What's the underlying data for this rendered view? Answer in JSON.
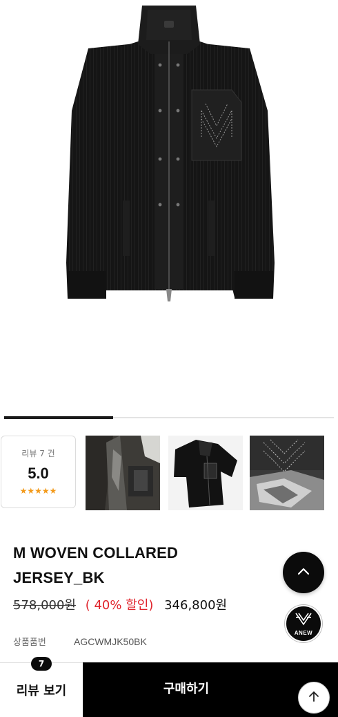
{
  "product": {
    "title_line1": "M WOVEN COLLARED",
    "title_line2": "JERSEY_BK",
    "original_price": "578,000원",
    "discount": "( 40% 할인)",
    "final_price": "346,800원",
    "code_label": "상품품번",
    "code_value": "AGCWMJK50BK",
    "garment_embroidery": "ANEW"
  },
  "gallery": {
    "progress_fraction": 0.33
  },
  "review_summary": {
    "count_label": "리뷰 7 건",
    "score": "5.0",
    "stars": "★★★★★",
    "star_color": "#f39a1a"
  },
  "thumbnails": [
    {
      "name": "thumb-detail-front"
    },
    {
      "name": "thumb-flatlay-back"
    },
    {
      "name": "thumb-pocket-closeup"
    }
  ],
  "fab": {
    "scroll_top_icon": "chevron-up-icon",
    "brand_logo_text": "ANEW"
  },
  "bottom_bar": {
    "review_button_label": "리뷰 보기",
    "review_badge_count": "7",
    "buy_button_label": "구매하기",
    "scroll_icon": "arrow-up-icon"
  },
  "colors": {
    "accent_red": "#e0232b",
    "primary_black": "#000000"
  }
}
